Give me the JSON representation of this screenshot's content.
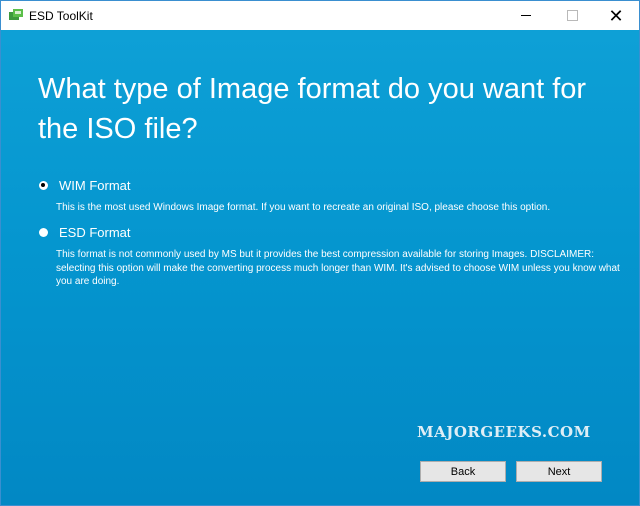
{
  "window": {
    "title": "ESD ToolKit",
    "app_icon": "esd-toolkit-icon",
    "controls": {
      "minimize": "minimize-icon",
      "maximize": "maximize-icon",
      "close": "close-icon",
      "close_glyph": "✕"
    }
  },
  "page": {
    "heading": "What type of Image format do you want for the ISO file?"
  },
  "options": [
    {
      "label": "WIM Format",
      "selected": true,
      "description": "This is the most used Windows Image format. If you want to recreate an original ISO, please choose this option."
    },
    {
      "label": "ESD Format",
      "selected": false,
      "description": "This format is not commonly used by MS but it provides the best compression available for storing Images. DISCLAIMER: selecting this option will make the converting process much longer than WIM. It's advised to choose WIM unless you know what you are doing."
    }
  ],
  "watermark": "MAJORGEEKS.COM",
  "buttons": {
    "back": "Back",
    "next": "Next"
  },
  "colors": {
    "background": "#0596cf",
    "titlebar": "#ffffff",
    "button": "#e6e6e6"
  }
}
